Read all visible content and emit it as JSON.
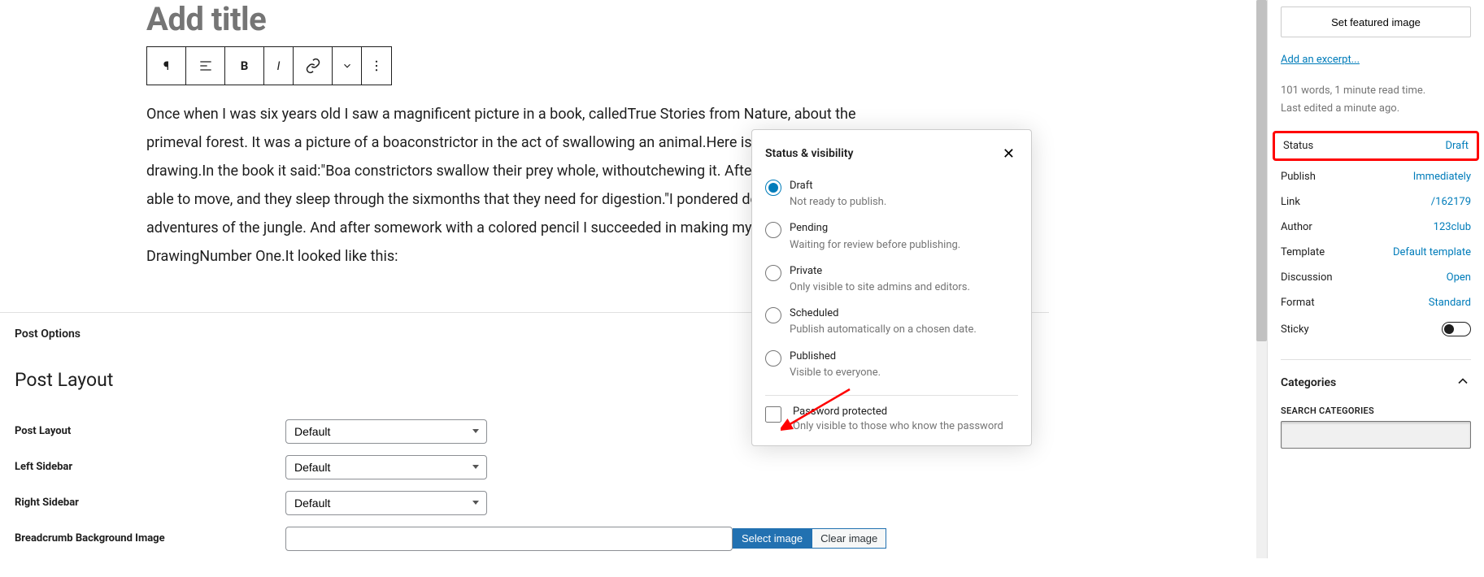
{
  "editor": {
    "title_placeholder": "Add title",
    "paragraph": "Once when I was six years old I saw a magnificent picture in a book, calledTrue Stories from Nature, about the primeval forest. It was a picture of a boaconstrictor in the act of swallowing an animal.Here is a copy of the drawing.In the book it said:\"Boa constrictors swallow their prey whole, withoutchewing it. After that they are not able to move, and they sleep through the sixmonths that they need for digestion.\"I pondered deeply, then, over the adventures of the jungle. And after somework with a colored pencil I succeeded in making my first drawing.My DrawingNumber One.It looked like this:"
  },
  "post_options": {
    "heading": "Post Options",
    "layout_heading": "Post Layout",
    "fields": {
      "post_layout": {
        "label": "Post Layout",
        "value": "Default"
      },
      "left_sidebar": {
        "label": "Left Sidebar",
        "value": "Default"
      },
      "right_sidebar": {
        "label": "Right Sidebar",
        "value": "Default"
      },
      "breadcrumb_bg": {
        "label": "Breadcrumb Background Image"
      }
    },
    "buttons": {
      "select_image": "Select image",
      "clear_image": "Clear image"
    }
  },
  "status_popup": {
    "title": "Status & visibility",
    "options": [
      {
        "label": "Draft",
        "desc": "Not ready to publish.",
        "checked": true
      },
      {
        "label": "Pending",
        "desc": "Waiting for review before publishing.",
        "checked": false
      },
      {
        "label": "Private",
        "desc": "Only visible to site admins and editors.",
        "checked": false
      },
      {
        "label": "Scheduled",
        "desc": "Publish automatically on a chosen date.",
        "checked": false
      },
      {
        "label": "Published",
        "desc": "Visible to everyone.",
        "checked": false
      }
    ],
    "password": {
      "label": "Password protected",
      "desc": "Only visible to those who know the password"
    }
  },
  "sidebar": {
    "featured_btn": "Set featured image",
    "excerpt_link": "Add an excerpt...",
    "meta1": "101 words, 1 minute read time.",
    "meta2": "Last edited a minute ago.",
    "rows": {
      "status": {
        "label": "Status",
        "value": "Draft"
      },
      "publish": {
        "label": "Publish",
        "value": "Immediately"
      },
      "link": {
        "label": "Link",
        "value": "/162179"
      },
      "author": {
        "label": "Author",
        "value": "123club"
      },
      "template": {
        "label": "Template",
        "value": "Default template"
      },
      "discussion": {
        "label": "Discussion",
        "value": "Open"
      },
      "format": {
        "label": "Format",
        "value": "Standard"
      },
      "sticky": {
        "label": "Sticky"
      }
    },
    "categories": {
      "title": "Categories",
      "search_label": "SEARCH CATEGORIES"
    }
  }
}
